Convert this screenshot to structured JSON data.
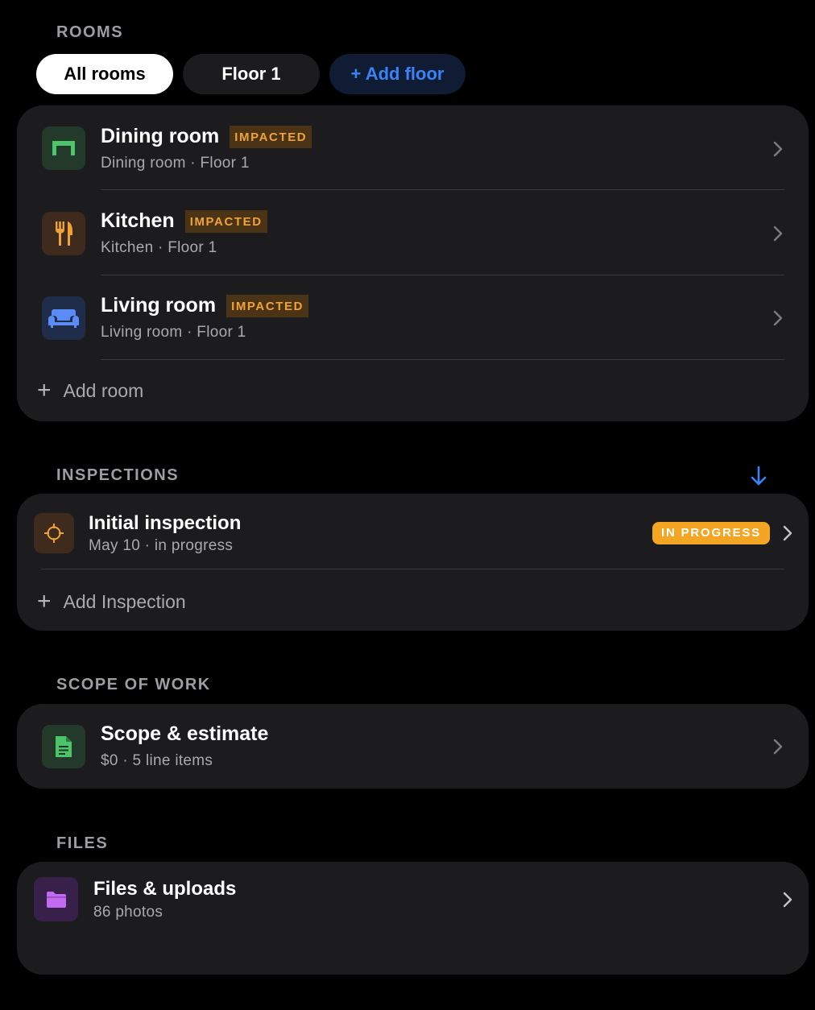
{
  "rooms": {
    "section_title": "ROOMS",
    "filters": [
      {
        "label": "All rooms",
        "active": true
      },
      {
        "label": "Floor 1",
        "active": false
      },
      {
        "label": "+ Add floor",
        "active": false
      }
    ],
    "items": [
      {
        "name": "Dining room",
        "tag": "IMPACTED",
        "subtitle": "Dining room · Floor 1",
        "icon": "table-icon"
      },
      {
        "name": "Kitchen",
        "tag": "IMPACTED",
        "subtitle": "Kitchen · Floor 1",
        "icon": "fork-knife-icon"
      },
      {
        "name": "Living room",
        "tag": "IMPACTED",
        "subtitle": "Living room · Floor 1",
        "icon": "sofa-icon"
      }
    ],
    "add_label": "Add room"
  },
  "inspections": {
    "section_title": "INSPECTIONS",
    "items": [
      {
        "name": "Initial inspection",
        "subtitle": "May 10 · in progress",
        "badge": "IN PROGRESS",
        "icon": "crosshair-icon"
      }
    ],
    "add_label": "Add Inspection"
  },
  "scope": {
    "section_title": "SCOPE OF WORK",
    "item": {
      "name": "Scope & estimate",
      "subtitle": "$0 · 5 line items",
      "icon": "document-icon"
    }
  },
  "files": {
    "section_title": "FILES",
    "item": {
      "name": "Files & uploads",
      "subtitle": "86 photos",
      "icon": "folder-icon"
    }
  },
  "colors": {
    "background": "#000000",
    "card": "#1c1c1e",
    "accent_blue": "#3b82f6",
    "impacted_tag_text": "#f0a23a",
    "in_progress_badge": "#f5a524"
  }
}
